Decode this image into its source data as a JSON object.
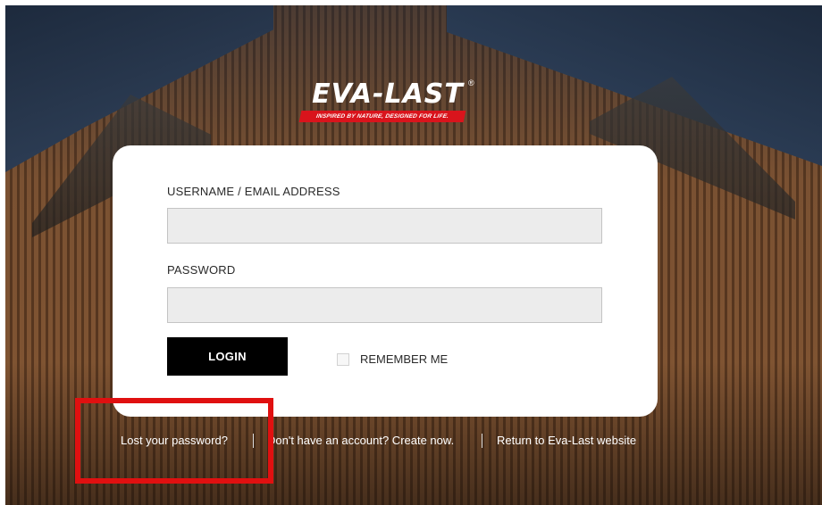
{
  "brand": {
    "name": "EVA-LAST",
    "registered_mark": "®",
    "tagline": "INSPIRED BY NATURE, DESIGNED FOR LIFE."
  },
  "form": {
    "username_label": "USERNAME / EMAIL ADDRESS",
    "username_value": "",
    "password_label": "PASSWORD",
    "password_value": "",
    "login_label": "LOGIN",
    "remember_label": "REMEMBER ME",
    "remember_checked": false
  },
  "footer_links": {
    "lost_password": "Lost your password?",
    "create_account": "Don't have an account? Create now.",
    "return_site": "Return to Eva-Last website"
  },
  "colors": {
    "accent": "#d9141c",
    "button": "#000000",
    "highlight_box": "#e01010"
  }
}
